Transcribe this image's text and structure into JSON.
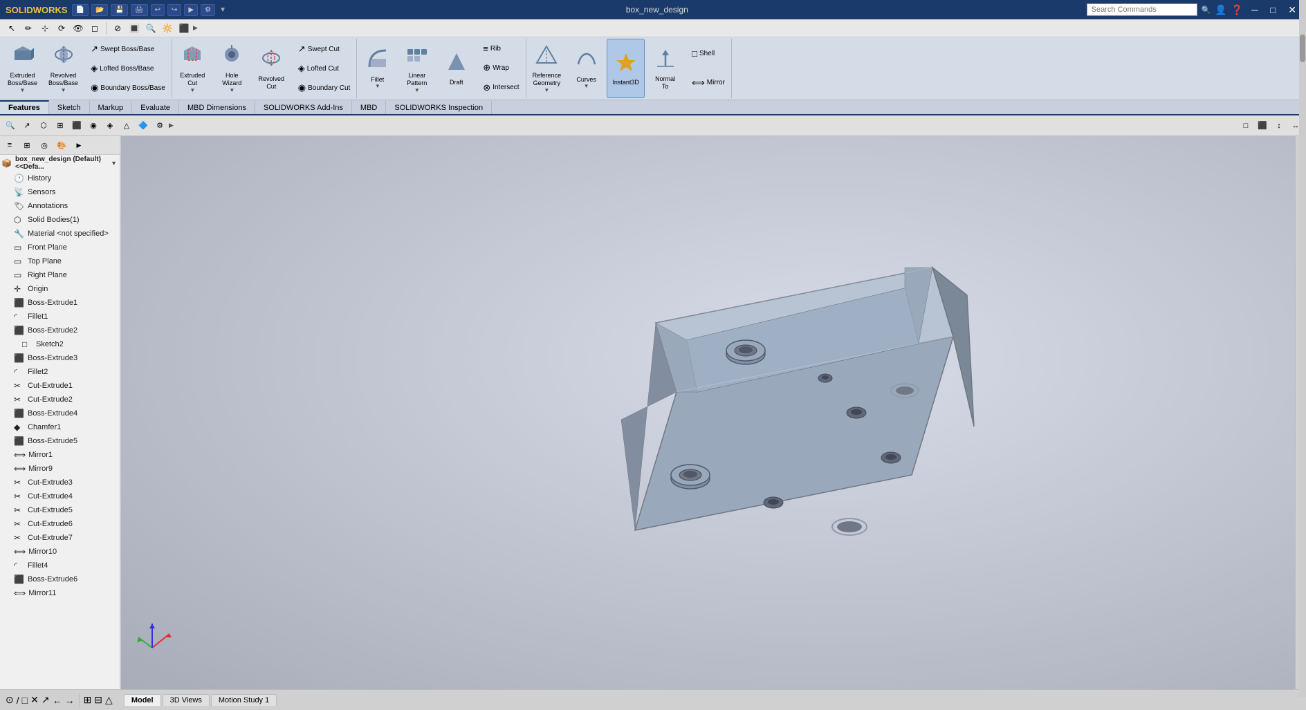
{
  "titlebar": {
    "logo": "SOLIDWORKS",
    "title": "box_new_design",
    "search_placeholder": "Search Commands",
    "win_buttons": [
      "─",
      "□",
      "✕"
    ]
  },
  "ribbon": {
    "tabs": [
      "Features",
      "Sketch",
      "Markup",
      "Evaluate",
      "MBD Dimensions",
      "SOLIDWORKS Add-Ins",
      "MBD",
      "SOLIDWORKS Inspection"
    ],
    "active_tab": "Features",
    "groups": {
      "extruded_bossbase": {
        "icon": "⬛",
        "label": "Extruded\nBoss/Base"
      },
      "revolved_bossbase": {
        "icon": "◷",
        "label": "Revolved\nBoss/Base"
      },
      "lofted_bossbase": {
        "icon": "◈",
        "label": "Lofted Boss/Base"
      },
      "boundary_bossbase": {
        "icon": "◉",
        "label": "Boundary Boss/Base"
      },
      "swept_bossbase": {
        "icon": "↗",
        "label": "Swept Boss/Base"
      },
      "extruded_cut": {
        "icon": "⬛",
        "label": "Extruded\nCut"
      },
      "hole_wizard": {
        "icon": "⚙",
        "label": "Hole\nWizard"
      },
      "revolved_cut": {
        "icon": "◷",
        "label": "Revolved\nCut"
      },
      "swept_cut": {
        "icon": "↗",
        "label": "Swept Cut"
      },
      "lofted_cut": {
        "icon": "◈",
        "label": "Lofted Cut"
      },
      "boundary_cut": {
        "icon": "◉",
        "label": "Boundary Cut"
      },
      "fillet": {
        "icon": "◜",
        "label": "Fillet"
      },
      "linear_pattern": {
        "icon": "⊞",
        "label": "Linear\nPattern"
      },
      "draft": {
        "icon": "◺",
        "label": "Draft"
      },
      "rib": {
        "icon": "≡",
        "label": "Rib"
      },
      "wrap": {
        "icon": "⊕",
        "label": "Wrap"
      },
      "intersect": {
        "icon": "⊗",
        "label": "Intersect"
      },
      "reference_geometry": {
        "icon": "△",
        "label": "Reference\nGeometry"
      },
      "curves": {
        "icon": "∿",
        "label": "Curves"
      },
      "instant3d": {
        "icon": "⚡",
        "label": "Instant3D"
      },
      "normal_to": {
        "icon": "↑",
        "label": "Normal\nTo"
      },
      "shell": {
        "icon": "□",
        "label": "Shell"
      },
      "mirror": {
        "icon": "⟺",
        "label": "Mirror"
      }
    }
  },
  "feature_tree": {
    "root": "box_new_design (Default) <<Defa...",
    "items": [
      {
        "icon": "🕐",
        "label": "History",
        "indent": 1
      },
      {
        "icon": "📡",
        "label": "Sensors",
        "indent": 1
      },
      {
        "icon": "🏷",
        "label": "Annotations",
        "indent": 1
      },
      {
        "icon": "⬡",
        "label": "Solid Bodies(1)",
        "indent": 1
      },
      {
        "icon": "🔧",
        "label": "Material <not specified>",
        "indent": 1
      },
      {
        "icon": "▭",
        "label": "Front Plane",
        "indent": 1
      },
      {
        "icon": "▭",
        "label": "Top Plane",
        "indent": 1
      },
      {
        "icon": "▭",
        "label": "Right Plane",
        "indent": 1
      },
      {
        "icon": "✛",
        "label": "Origin",
        "indent": 1
      },
      {
        "icon": "⬛",
        "label": "Boss-Extrude1",
        "indent": 1
      },
      {
        "icon": "◜",
        "label": "Fillet1",
        "indent": 1
      },
      {
        "icon": "⬛",
        "label": "Boss-Extrude2",
        "indent": 1
      },
      {
        "icon": "✏",
        "label": "Sketch2",
        "indent": 2
      },
      {
        "icon": "⬛",
        "label": "Boss-Extrude3",
        "indent": 1
      },
      {
        "icon": "◜",
        "label": "Fillet2",
        "indent": 1
      },
      {
        "icon": "✂",
        "label": "Cut-Extrude1",
        "indent": 1
      },
      {
        "icon": "✂",
        "label": "Cut-Extrude2",
        "indent": 1
      },
      {
        "icon": "⬛",
        "label": "Boss-Extrude4",
        "indent": 1
      },
      {
        "icon": "◆",
        "label": "Chamfer1",
        "indent": 1
      },
      {
        "icon": "⬛",
        "label": "Boss-Extrude5",
        "indent": 1
      },
      {
        "icon": "⟺",
        "label": "Mirror1",
        "indent": 1
      },
      {
        "icon": "⟺",
        "label": "Mirror9",
        "indent": 1
      },
      {
        "icon": "✂",
        "label": "Cut-Extrude3",
        "indent": 1
      },
      {
        "icon": "✂",
        "label": "Cut-Extrude4",
        "indent": 1
      },
      {
        "icon": "✂",
        "label": "Cut-Extrude5",
        "indent": 1
      },
      {
        "icon": "✂",
        "label": "Cut-Extrude6",
        "indent": 1
      },
      {
        "icon": "✂",
        "label": "Cut-Extrude7",
        "indent": 1
      },
      {
        "icon": "⟺",
        "label": "Mirror10",
        "indent": 1
      },
      {
        "icon": "◜",
        "label": "Fillet4",
        "indent": 1
      },
      {
        "icon": "⬛",
        "label": "Boss-Extrude6",
        "indent": 1
      },
      {
        "icon": "⟺",
        "label": "Mirror11",
        "indent": 1
      }
    ]
  },
  "bottom_tabs": [
    "Model",
    "3D Views",
    "Motion Study 1"
  ],
  "active_bottom_tab": "Model",
  "viewport": {
    "background_gradient": "radial-gradient(ellipse at 60% 40%, #d8dce8 0%, #c0c4d0 50%, #a8acb8 100%)"
  },
  "toolbar_icons": [
    "🏠",
    "📄",
    "💾",
    "🖨",
    "↩",
    "↪",
    "▶",
    "⚙"
  ],
  "view_icons": [
    "🔍",
    "⬡",
    "⊞",
    "◯",
    "□",
    "△",
    "◉",
    "◈"
  ],
  "colors": {
    "titlebar_bg": "#1a3a6b",
    "ribbon_bg": "#d4dce8",
    "ribbon_tab_active": "#1a3a6b",
    "feature_tree_bg": "#f0f0f0",
    "model_body": "#8090a8",
    "model_face": "#a0b0c8",
    "model_shadow": "#606878"
  }
}
